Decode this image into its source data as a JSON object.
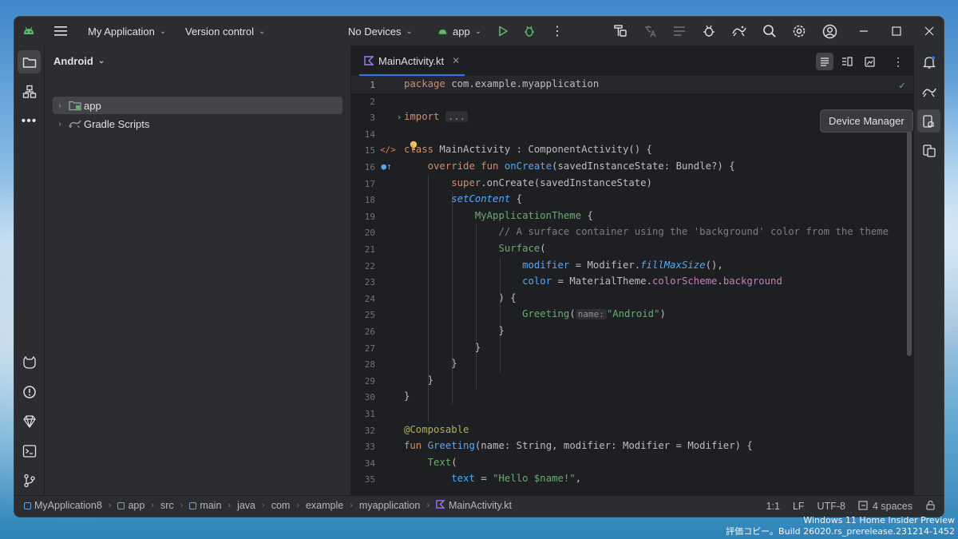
{
  "titlebar": {
    "project_name": "My Application",
    "vcs_label": "Version control",
    "device_label": "No Devices",
    "run_config": "app"
  },
  "project_panel": {
    "view_mode": "Android",
    "items": [
      {
        "label": "app"
      },
      {
        "label": "Gradle Scripts"
      }
    ]
  },
  "editor": {
    "tab_label": "MainActivity.kt",
    "tab_close": "✕",
    "check_mark": "✓"
  },
  "code": {
    "lines": [
      {
        "n": "1"
      },
      {
        "n": "2"
      },
      {
        "n": "3"
      },
      {
        "n": "14"
      },
      {
        "n": "15"
      },
      {
        "n": "16"
      },
      {
        "n": "17"
      },
      {
        "n": "18"
      },
      {
        "n": "19"
      },
      {
        "n": "20"
      },
      {
        "n": "21"
      },
      {
        "n": "22"
      },
      {
        "n": "23"
      },
      {
        "n": "24"
      },
      {
        "n": "25"
      },
      {
        "n": "26"
      },
      {
        "n": "27"
      },
      {
        "n": "28"
      },
      {
        "n": "29"
      },
      {
        "n": "30"
      },
      {
        "n": "31"
      },
      {
        "n": "32"
      },
      {
        "n": "33"
      },
      {
        "n": "34"
      },
      {
        "n": "35"
      }
    ],
    "t": {
      "package_kw": "package",
      "package_name": " com.example.myapplication",
      "import_kw": "import",
      "import_fold": "...",
      "class_kw": "class",
      "class_decl": " MainActivity : ComponentActivity() {",
      "override_kw": "override fun",
      "oncreate_fn": "onCreate",
      "oncreate_params": "(savedInstanceState: Bundle?) {",
      "super_kw": "super",
      "super_call": ".onCreate(savedInstanceState)",
      "setcontent": "setContent",
      "brace_open": " {",
      "theme": "MyApplicationTheme",
      "comment": "// A surface container using the 'background' color from the theme",
      "surface": "Surface",
      "paren_open": "(",
      "modifier_named": "modifier",
      "modifier_rhs_1": " = Modifier.",
      "fill": "fillMaxSize",
      "modifier_rhs_2": "(),",
      "color_named": "color",
      "color_rhs_1": " = MaterialTheme.",
      "color_scheme": "colorScheme",
      "dot": ".",
      "background": "background",
      "close_paren_brace": ") {",
      "greeting_call": "Greeting",
      "hint_name": "name:",
      "android_str": "\"Android\"",
      "paren_close": ")",
      "brace_close": "}",
      "composable": "@Composable",
      "fun_kw": "fun",
      "greeting_fn": "Greeting",
      "greeting_params": "(name: String, modifier: Modifier = Modifier) {",
      "text_call": "Text",
      "text_named": "text",
      "equals": " = ",
      "hello_str": "\"Hello $name!\"",
      "comma": ","
    }
  },
  "tooltip": "Device Manager",
  "breadcrumbs": [
    "MyApplication8",
    "app",
    "src",
    "main",
    "java",
    "com",
    "example",
    "myapplication",
    "MainActivity.kt"
  ],
  "status": {
    "position": "1:1",
    "line_sep": "LF",
    "encoding": "UTF-8",
    "indent": "4 spaces"
  },
  "watermark": {
    "line1": "Windows 11 Home Insider Preview",
    "line2": "評価コピー。Build 26020.rs_prerelease.231214-1452"
  },
  "colors": {
    "accent": "#3574f0",
    "android_green": "#5fb865",
    "editor_bg": "#1e1f22",
    "chrome_bg": "#2b2d30"
  },
  "icons": [
    "android-logo-icon",
    "hamburger-menu-icon",
    "run-icon",
    "debug-icon",
    "search-icon",
    "settings-icon",
    "account-icon",
    "folder-icon",
    "structure-icon",
    "more-icon",
    "notifications-icon",
    "gemini-icon",
    "device-manager-icon",
    "running-devices-icon",
    "terminal-icon",
    "git-icon",
    "problems-icon",
    "build-variants-icon",
    "lock-icon"
  ]
}
